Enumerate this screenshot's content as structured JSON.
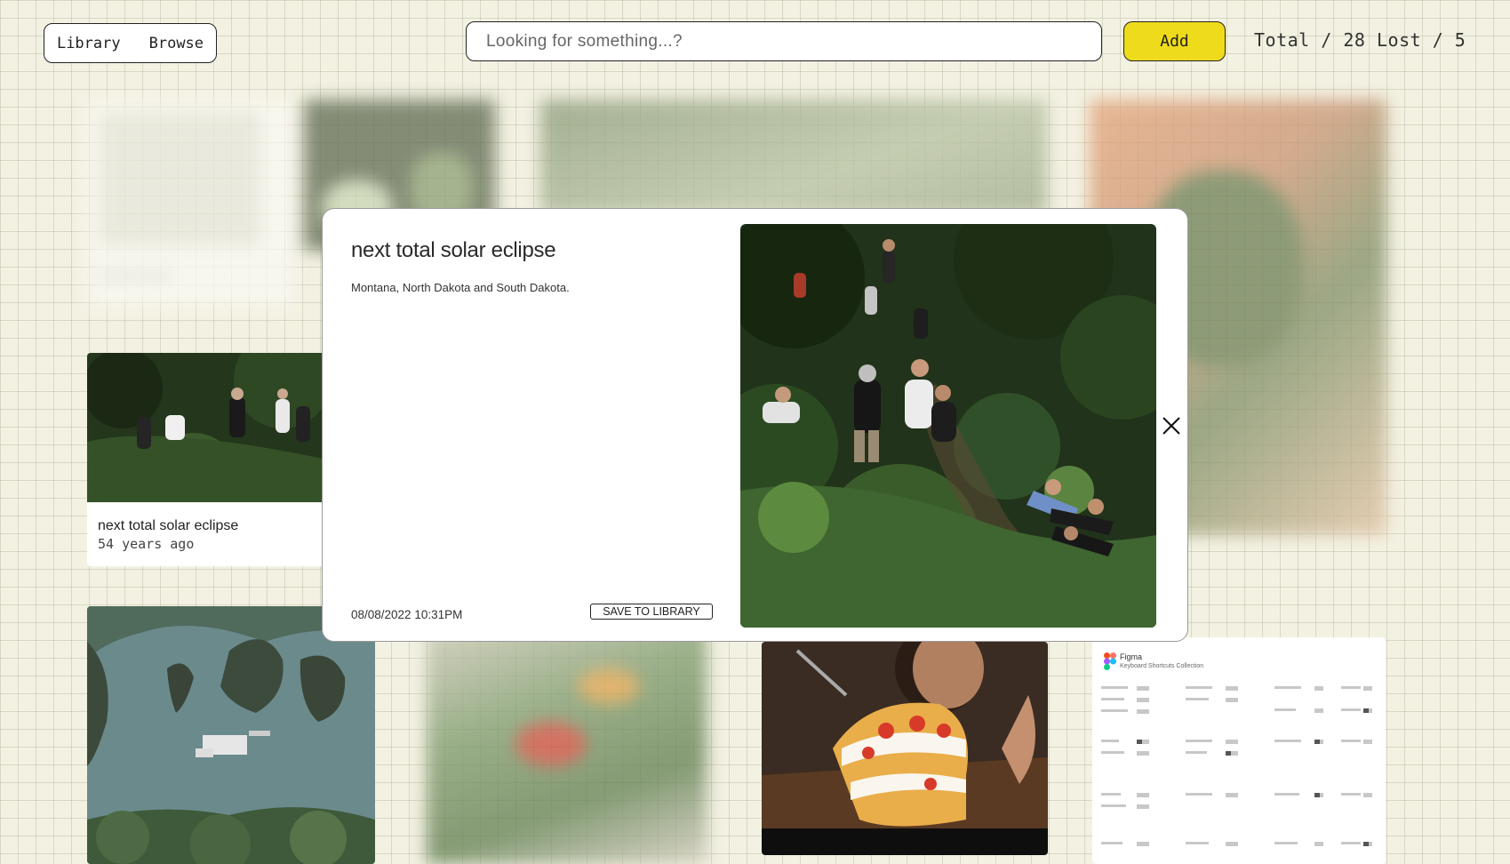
{
  "header": {
    "nav": {
      "library_label": "Library",
      "browse_label": "Browse"
    },
    "search": {
      "placeholder": "Looking for something...?"
    },
    "add_label": "Add",
    "stats": {
      "total": "Total / 28",
      "lost": "Lost / 5"
    }
  },
  "cards": {
    "eclipse": {
      "title": "next total solar eclipse",
      "time": "54 years ago"
    },
    "blurred": {
      "title": "xxxxxxx xxxxx",
      "time": "xx xxxxx xxx"
    }
  },
  "figma_card": {
    "app": "Figma",
    "subtitle": "Keyboard Shortcuts Collection"
  },
  "modal": {
    "title": "next total solar eclipse",
    "description": "Montana, North Dakota and South Dakota.",
    "date": "08/08/2022 10:31PM",
    "save_label": "SAVE TO LIBRARY"
  },
  "colors": {
    "background": "#f3f1e2",
    "accent": "#eedc1c",
    "border": "#222222"
  }
}
